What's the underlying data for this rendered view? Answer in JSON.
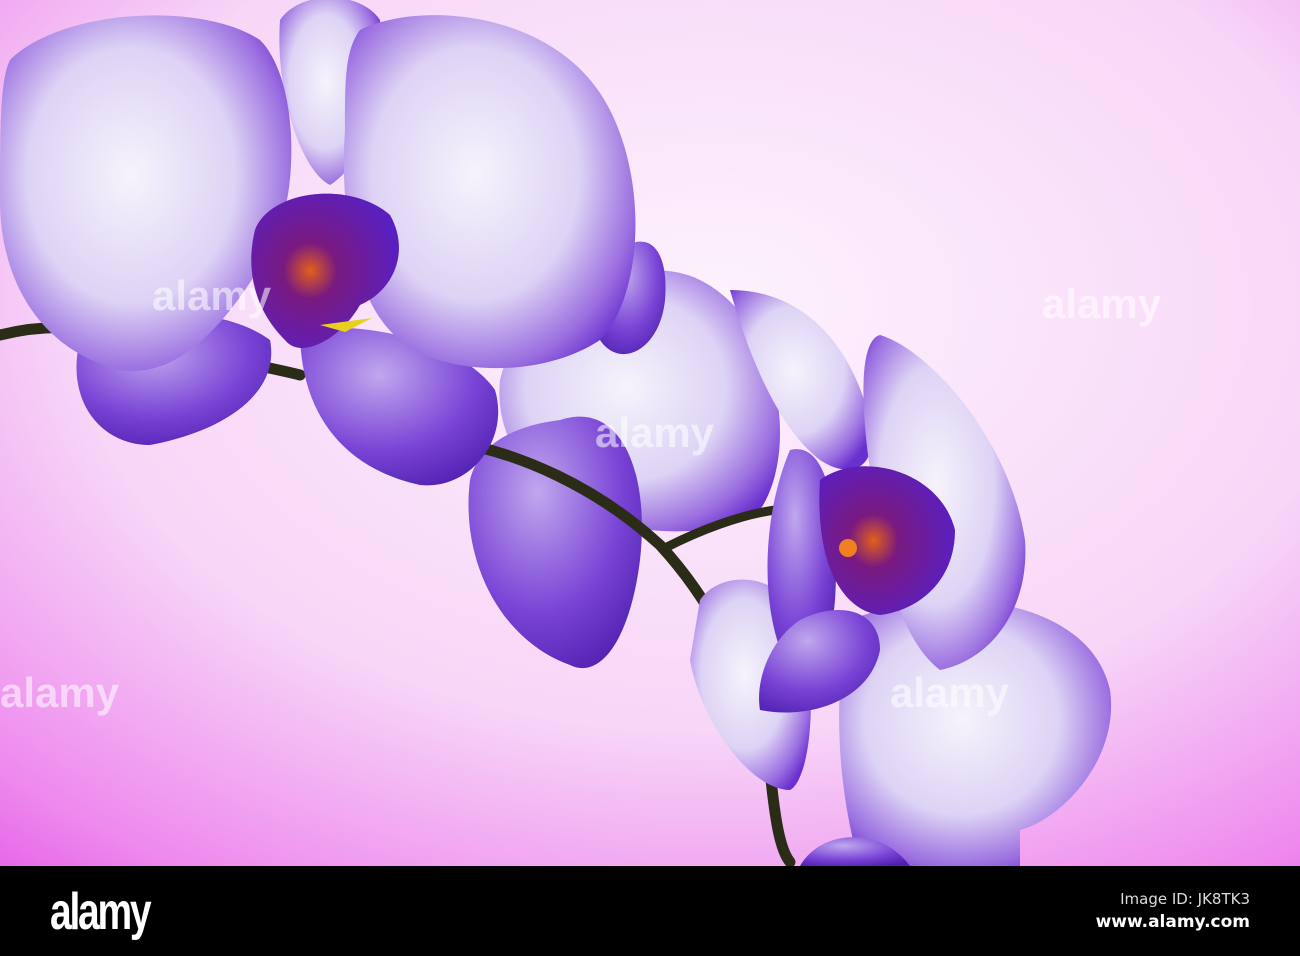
{
  "photo": {
    "subject": "purple orchid",
    "colors": {
      "background_light": "#fbe6fb",
      "background_magenta": "#e85ce8",
      "petal_white": "#f2eefb",
      "petal_purple": "#6a2fd0",
      "stem": "#2a2a18",
      "lip_orange": "#e0601a"
    },
    "watermark_text": "alamy"
  },
  "footer": {
    "logo": "alamy",
    "image_id": "Image ID: JK8TK3",
    "url": "www.alamy.com"
  }
}
